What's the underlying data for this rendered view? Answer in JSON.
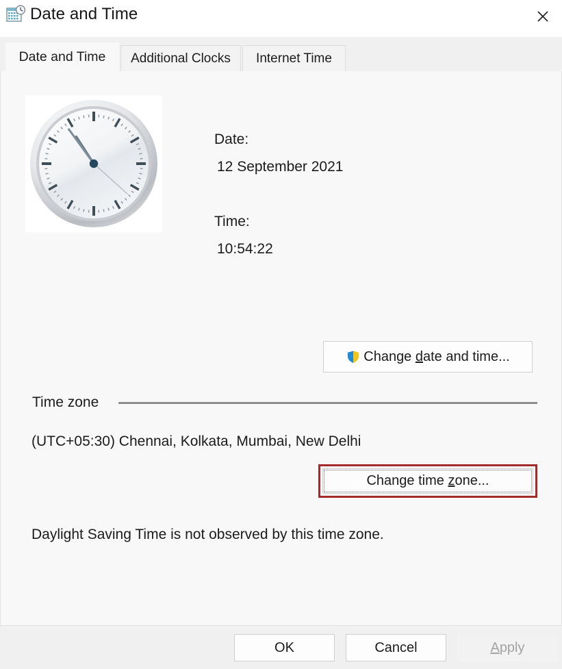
{
  "window": {
    "title": "Date and Time",
    "icon": "calendar-clock-icon",
    "close_label": "✕"
  },
  "tabs": [
    {
      "label": "Date and Time",
      "active": true
    },
    {
      "label": "Additional Clocks",
      "active": false
    },
    {
      "label": "Internet Time",
      "active": false
    }
  ],
  "main": {
    "clock": {
      "icon": "analog-clock-image",
      "hour_angle": 327,
      "minute_angle": 324,
      "second_angle": 132
    },
    "date_label": "Date:",
    "date_value": "12 September 2021",
    "time_label": "Time:",
    "time_value": "10:54:22",
    "change_datetime_button": {
      "text_before": "Change ",
      "accel": "d",
      "text_after": "ate and time...",
      "full_label": "Change date and time...",
      "icon": "uac-shield-icon"
    },
    "timezone_group_label": "Time zone",
    "timezone_value": "(UTC+05:30) Chennai, Kolkata, Mumbai, New Delhi",
    "change_timezone_button": {
      "text_before": "Change time ",
      "accel": "z",
      "text_after": "one...",
      "full_label": "Change time zone...",
      "highlighted": true,
      "highlight_color": "#a32b2b"
    },
    "dst_note": "Daylight Saving Time is not observed by this time zone."
  },
  "footer": {
    "ok_label": "OK",
    "cancel_label": "Cancel",
    "apply": {
      "accel": "A",
      "text_after": "pply",
      "full_label": "Apply",
      "disabled": true
    }
  }
}
